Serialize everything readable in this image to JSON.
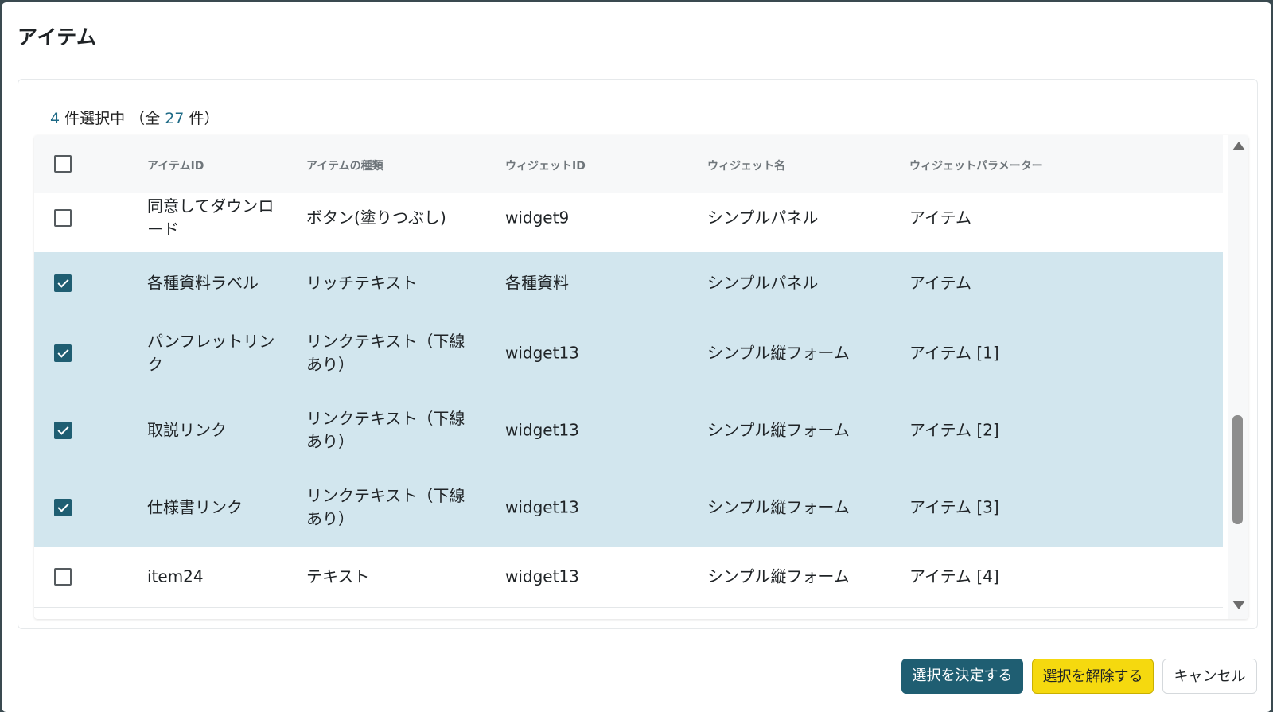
{
  "dialog": {
    "title": "アイテム"
  },
  "selection": {
    "selected_count": "4",
    "selected_suffix": " 件選択中 （全 ",
    "total_count": "27",
    "total_suffix": " 件）"
  },
  "table": {
    "headers": {
      "item_id": "アイテムID",
      "item_type": "アイテムの種類",
      "widget_id": "ウィジェットID",
      "widget_name": "ウィジェット名",
      "widget_param": "ウィジェットパラメーター"
    },
    "rows": [
      {
        "checked": false,
        "item_id": "同意してダウンロ\nード",
        "item_type": "ボタン(塗りつぶし)",
        "widget_id": "widget9",
        "widget_name": "シンプルパネル",
        "widget_param": "アイテム"
      },
      {
        "checked": true,
        "item_id": "各種資料ラベル",
        "item_type": "リッチテキスト",
        "widget_id": "各種資料",
        "widget_name": "シンプルパネル",
        "widget_param": "アイテム"
      },
      {
        "checked": true,
        "item_id": "パンフレットリン\nク",
        "item_type": "リンクテキスト（下線\nあり）",
        "widget_id": "widget13",
        "widget_name": "シンプル縦フォーム",
        "widget_param": "アイテム [1]"
      },
      {
        "checked": true,
        "item_id": "取説リンク",
        "item_type": "リンクテキスト（下線\nあり）",
        "widget_id": "widget13",
        "widget_name": "シンプル縦フォーム",
        "widget_param": "アイテム [2]"
      },
      {
        "checked": true,
        "item_id": "仕様書リンク",
        "item_type": "リンクテキスト（下線\nあり）",
        "widget_id": "widget13",
        "widget_name": "シンプル縦フォーム",
        "widget_param": "アイテム [3]"
      },
      {
        "checked": false,
        "item_id": "item24",
        "item_type": "テキスト",
        "widget_id": "widget13",
        "widget_name": "シンプル縦フォーム",
        "widget_param": "アイテム [4]"
      }
    ]
  },
  "buttons": {
    "confirm": "選択を決定する",
    "clear": "選択を解除する",
    "cancel": "キャンセル"
  },
  "colors": {
    "accent": "#1f5e72",
    "selected_row": "#d2e6ee",
    "clear_button": "#f5d90f"
  }
}
